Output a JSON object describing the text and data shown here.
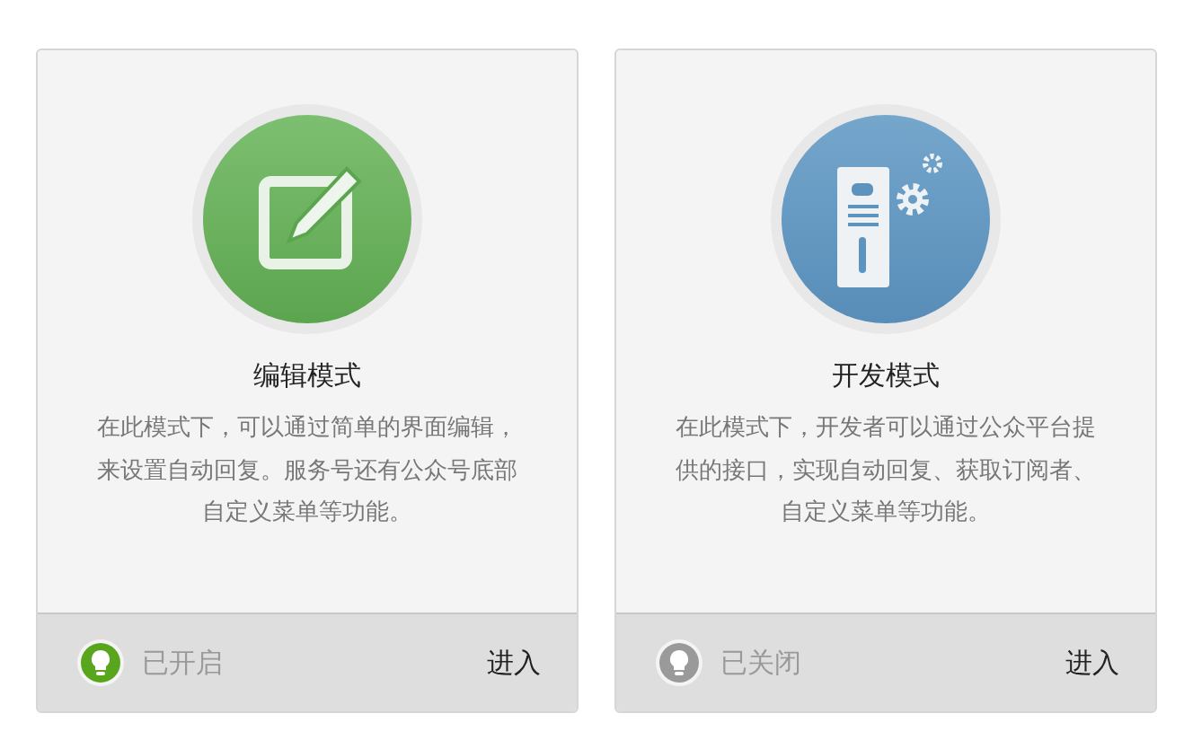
{
  "modes": [
    {
      "kind": "edit",
      "title": "编辑模式",
      "description": "在此模式下，可以通过简单的界面编辑，来设置自动回复。服务号还有公众号底部自定义菜单等功能。",
      "enabled": true,
      "status": "已开启",
      "action": "进入"
    },
    {
      "kind": "server",
      "title": "开发模式",
      "description": "在此模式下，开发者可以通过公众平台提供的接口，实现自动回复、获取订阅者、自定义菜单等功能。",
      "enabled": false,
      "status": "已关闭",
      "action": "进入"
    }
  ]
}
